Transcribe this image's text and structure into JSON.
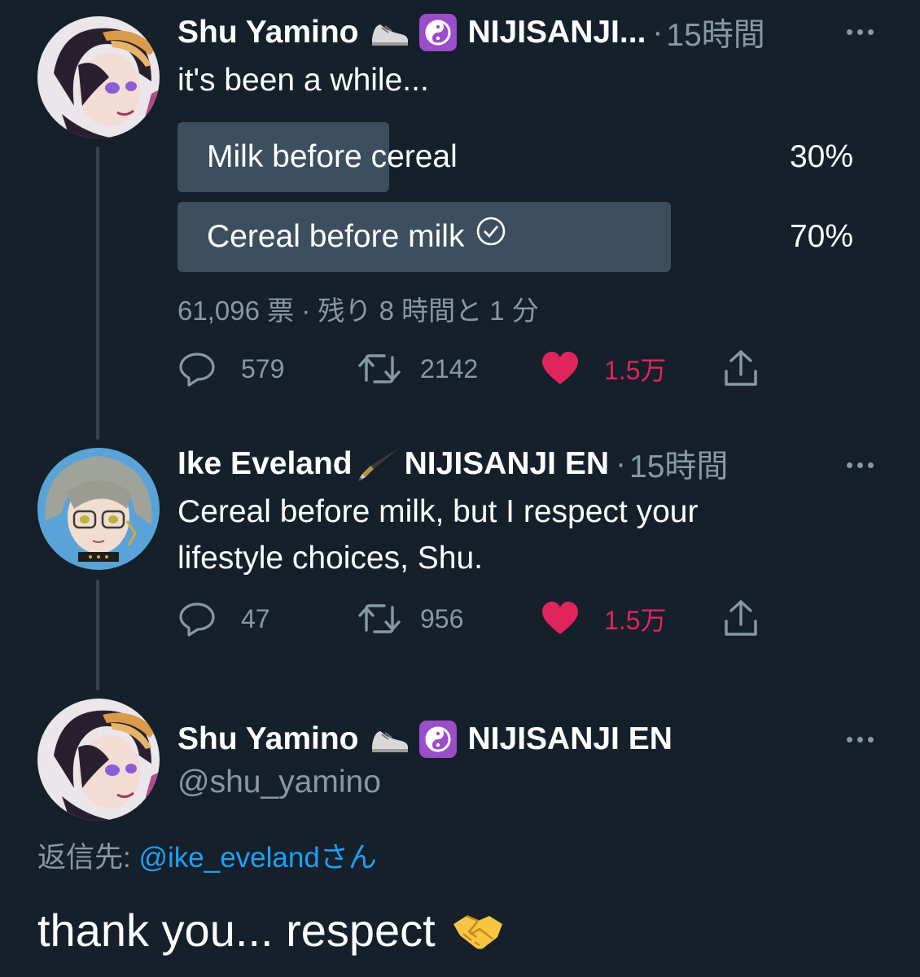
{
  "tweets": [
    {
      "name": "Shu Yamino",
      "affiliation": "NIJISANJI...",
      "time": "15時間",
      "text": "it's been a while...",
      "poll": {
        "options": [
          {
            "label": "Milk before cereal",
            "percent_text": "30%",
            "percent": 30,
            "selected": false
          },
          {
            "label": "Cereal before milk",
            "percent_text": "70%",
            "percent": 70,
            "selected": true
          }
        ],
        "meta": "61,096 票 · 残り 8 時間と 1 分"
      },
      "stats": {
        "replies": "579",
        "retweets": "2142",
        "likes": "1.5万"
      }
    },
    {
      "name": "Ike Eveland",
      "affiliation": "NIJISANJI EN",
      "time": "15時間",
      "text_lines": [
        "Cereal before milk, but I respect your",
        "lifestyle choices, Shu."
      ],
      "stats": {
        "replies": "47",
        "retweets": "956",
        "likes": "1.5万"
      }
    }
  ],
  "main_tweet": {
    "name": "Shu Yamino",
    "affiliation": "NIJISANJI EN",
    "handle": "@shu_yamino",
    "reply_prefix": "返信先:",
    "reply_handle": "@ike_eveland",
    "reply_suffix": "さん",
    "text": "thank you... respect"
  },
  "icons": {
    "reply": "reply-icon",
    "retweet": "retweet-icon",
    "like": "heart-icon",
    "share": "share-icon",
    "more": "more-icon",
    "sneaker": "sneaker-emoji",
    "yinyang": "yin-yang-emoji",
    "pen": "fountain-pen-emoji",
    "handshake": "handshake-emoji",
    "check": "check-circle-icon"
  },
  "colors": {
    "background": "#15202b",
    "text": "#ffffff",
    "secondary": "#8899a6",
    "link": "#1da1f2",
    "like": "#e0245e",
    "poll_fill": "#3d4f5e",
    "emoji_purple": "#9b4dca"
  }
}
